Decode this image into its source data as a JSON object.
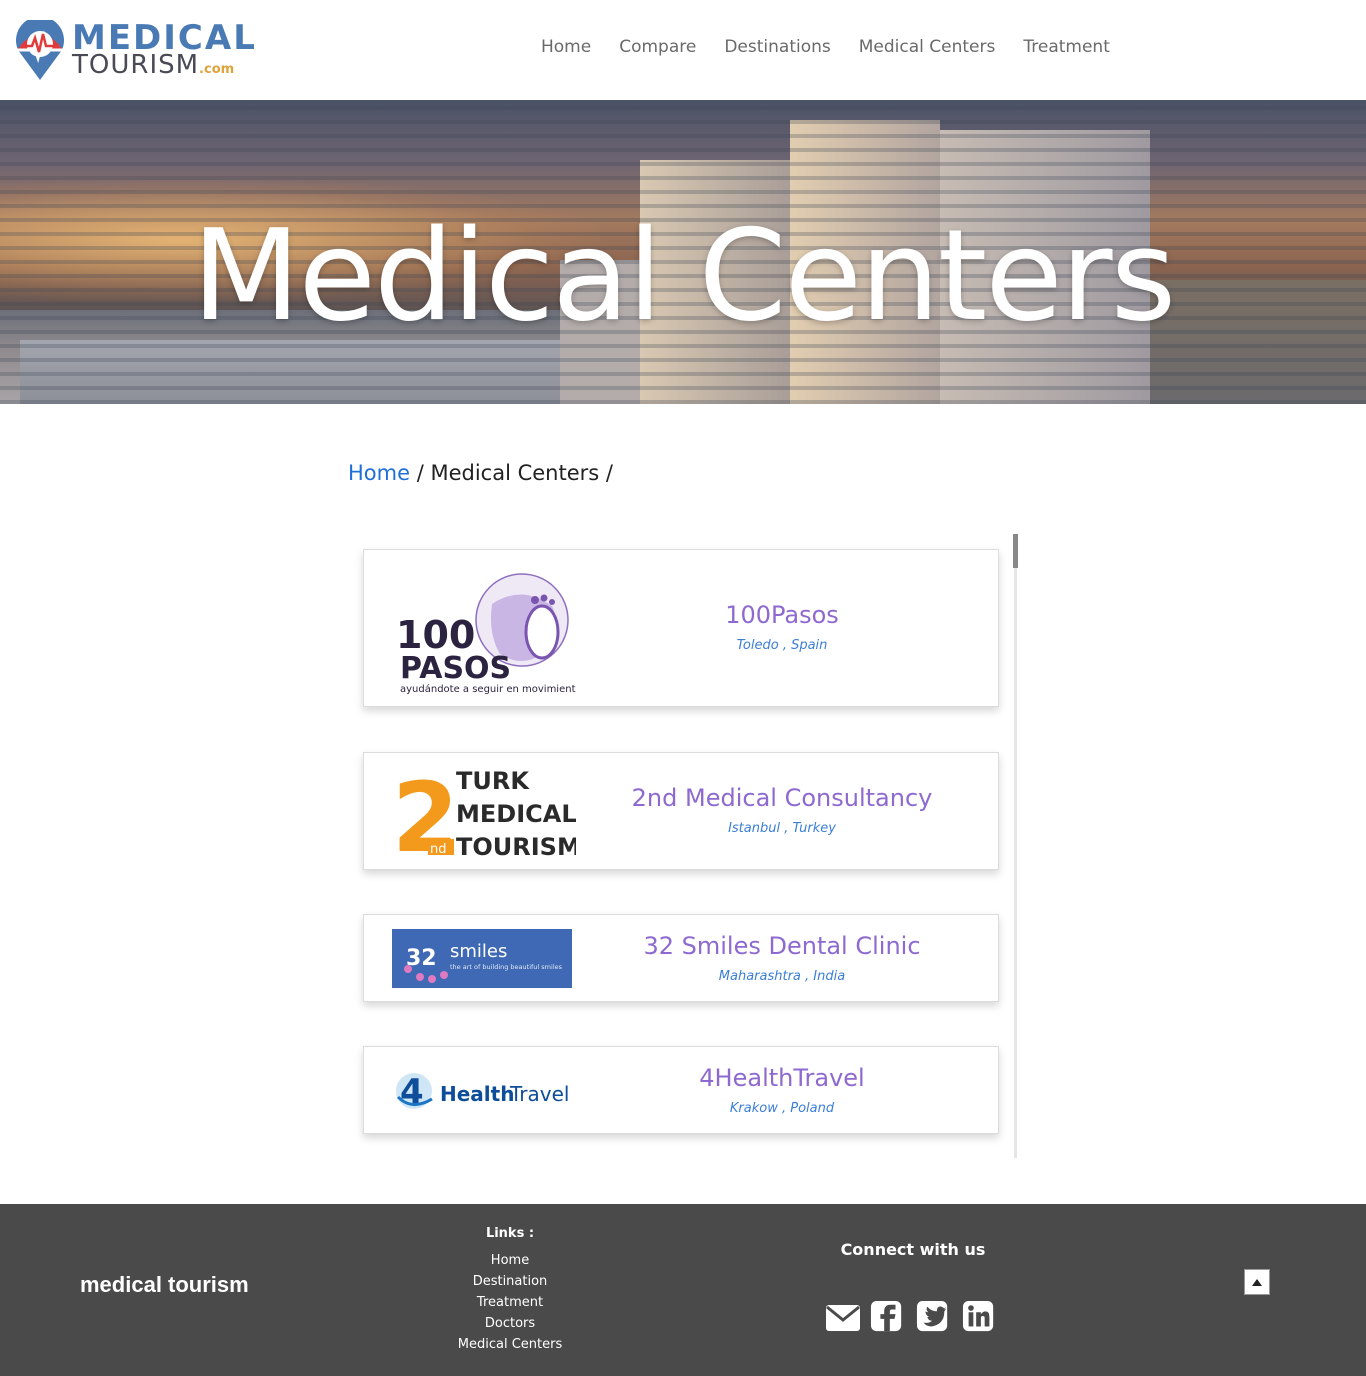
{
  "header": {
    "logo": {
      "line1": "MEDICAL",
      "line2": "TOURISM",
      "suffix": ".com"
    },
    "nav": [
      "Home",
      "Compare",
      "Destinations",
      "Medical Centers",
      "Treatment"
    ]
  },
  "hero": {
    "title": "Medical Centers"
  },
  "breadcrumb": {
    "home": "Home",
    "sep1": " / ",
    "current": "Medical Centers",
    "sep2": " /"
  },
  "centers": [
    {
      "name": "100Pasos",
      "location": "Toledo , Spain",
      "logo": {
        "line1": "100",
        "line2": "PASOS",
        "tagline": "ayudándote a seguir en movimiento"
      }
    },
    {
      "name": "2nd Medical Consultancy",
      "location": "Istanbul , Turkey",
      "logo": {
        "digit": "2",
        "sup": "nd",
        "line1": "TURK",
        "line2": "MEDICAL",
        "line3": "TOURISM"
      }
    },
    {
      "name": "32 Smiles Dental Clinic",
      "location": "Maharashtra , India",
      "logo": {
        "number": "32",
        "word": "smiles",
        "tagline": "the art of building beautiful smiles"
      }
    },
    {
      "name": "4HealthTravel",
      "location": "Krakow , Poland",
      "logo": {
        "digit": "4",
        "word1": "Health",
        "word2": "Travel"
      }
    }
  ],
  "footer": {
    "brand": "medical tourism",
    "links_title": "Links :",
    "links": [
      "Home",
      "Destination",
      "Treatment",
      "Doctors",
      "Medical Centers"
    ],
    "connect": "Connect with us",
    "socials": [
      "envelope-icon",
      "facebook-icon",
      "twitter-icon",
      "linkedin-icon"
    ]
  },
  "colors": {
    "accent": "#8d69d0",
    "link": "#1f70d6",
    "footer_bg": "#4a4a4a",
    "logo_blue": "#4a7ab4",
    "logo_red": "#e23a3a"
  }
}
